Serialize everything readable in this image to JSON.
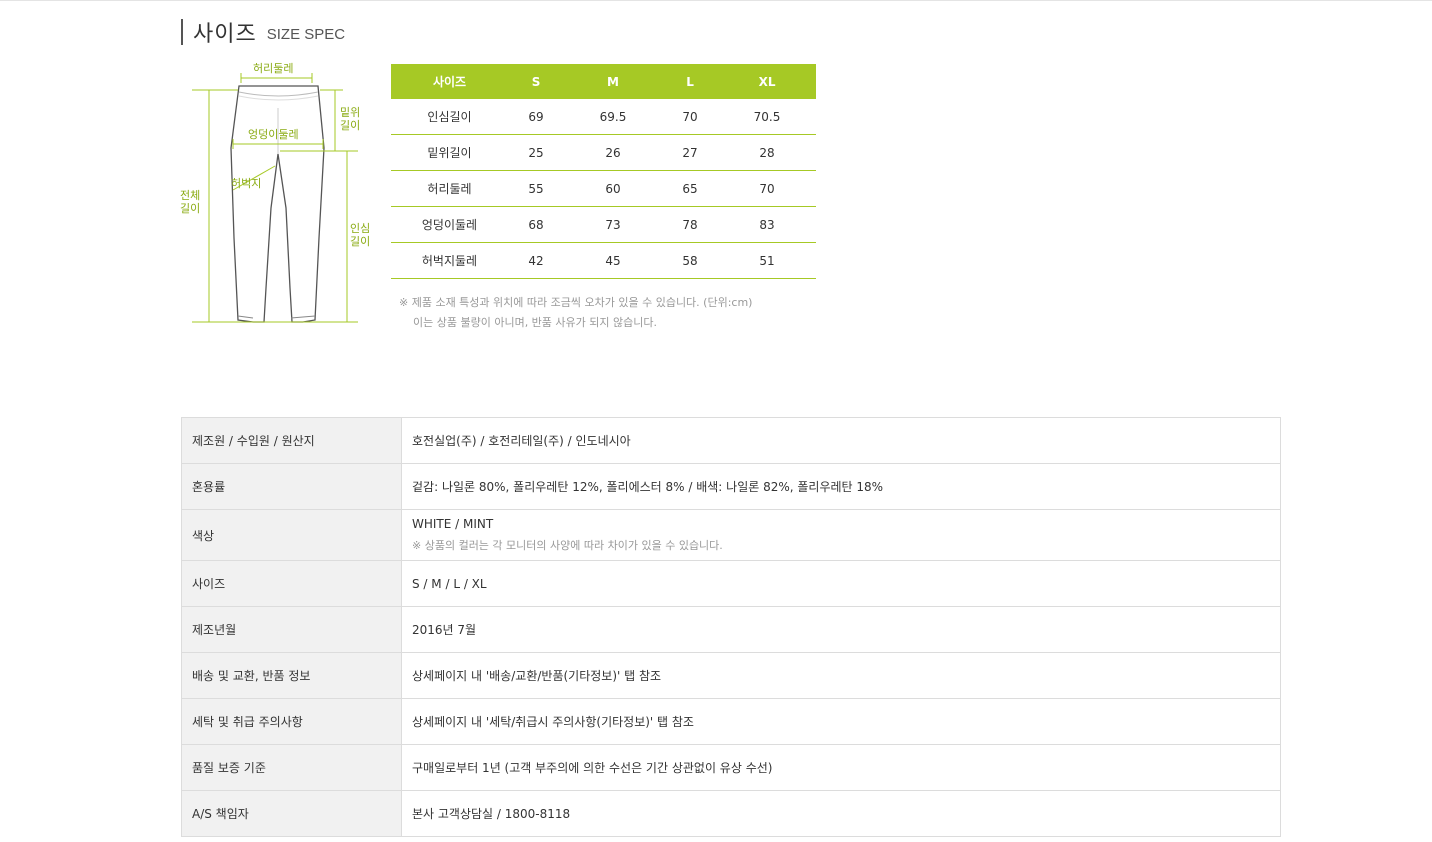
{
  "header": {
    "title_ko": "사이즈",
    "title_en": "SIZE SPEC"
  },
  "diagram": {
    "waist_label": "허리둘레",
    "rise_label": "밑위\n길이",
    "hip_label": "엉덩이둘레",
    "thigh_label": "허벅지",
    "total_label": "전체\n길이",
    "inseam_label": "인심\n길이",
    "accent_color": "#a6c925"
  },
  "size_table": {
    "headers": [
      "사이즈",
      "S",
      "M",
      "L",
      "XL"
    ],
    "rows": [
      [
        "인심길이",
        "69",
        "69.5",
        "70",
        "70.5"
      ],
      [
        "밑위길이",
        "25",
        "26",
        "27",
        "28"
      ],
      [
        "허리둘레",
        "55",
        "60",
        "65",
        "70"
      ],
      [
        "엉덩이둘레",
        "68",
        "73",
        "78",
        "83"
      ],
      [
        "허벅지둘레",
        "42",
        "45",
        "58",
        "51"
      ]
    ],
    "header_color": "#a6c925"
  },
  "note": {
    "line1": "※ 제품 소재 특성과 위치에 따라 조금씩 오차가 있을 수 있습니다. (단위:cm)",
    "line2": "이는 상품 불량이 아니며, 반품 사유가 되지 않습니다."
  },
  "info_table": {
    "rows": [
      {
        "label": "제조원 / 수입원 / 원산지",
        "value": "호전실업(주) / 호전리테일(주) / 인도네시아"
      },
      {
        "label": "혼용률",
        "value": "겉감: 나일론 80%, 폴리우레탄 12%, 폴리에스터 8% / 배색: 나일론 82%, 폴리우레탄 18%"
      },
      {
        "label": "색상",
        "value": "WHITE / MINT",
        "sub": "※ 상품의 컬러는 각 모니터의 사양에 따라 차이가 있을 수 있습니다."
      },
      {
        "label": "사이즈",
        "value": "S / M / L / XL"
      },
      {
        "label": "제조년월",
        "value": "2016년 7월"
      },
      {
        "label": "배송 및 교환, 반품 정보",
        "value": "상세페이지 내 '배송/교환/반품(기타정보)' 탭 참조"
      },
      {
        "label": "세탁 및 취급 주의사항",
        "value": "상세페이지 내 '세탁/취급시 주의사항(기타정보)' 탭 참조"
      },
      {
        "label": "품질 보증 기준",
        "value": "구매일로부터 1년 (고객 부주의에 의한 수선은 기간 상관없이 유상 수선)"
      },
      {
        "label": "A/S 책임자",
        "value": "본사 고객상담실 / 1800-8118"
      }
    ]
  }
}
